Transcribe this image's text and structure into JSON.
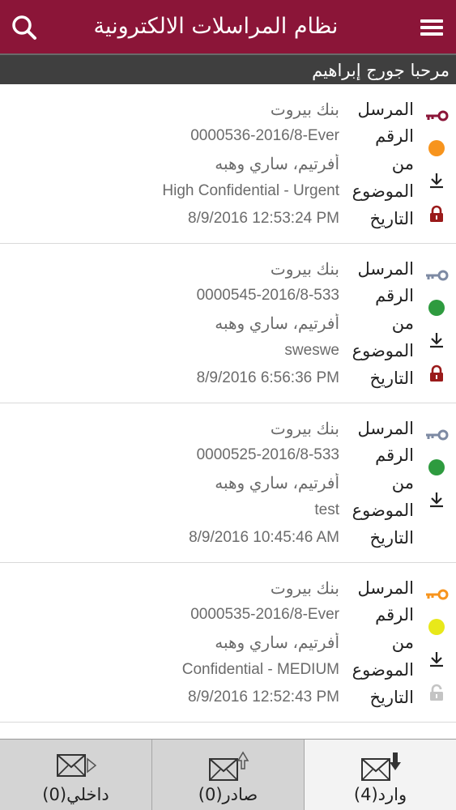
{
  "header": {
    "title": "نظام المراسلات الالكترونية",
    "search_icon": "search-icon",
    "menu_icon": "hamburger-menu-icon"
  },
  "welcome": "مرحبا جورج إبراهيم",
  "colors": {
    "header_bg": "#8b1538",
    "welcome_bg": "#3f3f3f",
    "orange": "#f7941d",
    "green": "#2e9b3f",
    "yellow": "#e8e81a",
    "lock_red": "#9a1a1a"
  },
  "labels": {
    "sender": "المرسل",
    "number": "الرقم",
    "from": "من",
    "subject": "الموضوع",
    "date": "التاريخ"
  },
  "messages": [
    {
      "sender": "بنك بيروت",
      "number": "0000536-2016/8-Ever",
      "from": "أفرتيم، ساري وهبه",
      "subject": "High Confidential - Urgent",
      "date": "8/9/2016 12:53:24 PM",
      "key_color": "#8b1538",
      "priority_color": "#f7941d",
      "lock": "locked-red"
    },
    {
      "sender": "بنك بيروت",
      "number": "0000545-2016/8-533",
      "from": "أفرتيم، ساري وهبه",
      "subject": "sweswe",
      "date": "8/9/2016 6:56:36 PM",
      "key_color": "#7d8aa3",
      "priority_color": "#2e9b3f",
      "lock": "locked-red"
    },
    {
      "sender": "بنك بيروت",
      "number": "0000525-2016/8-533",
      "from": "أفرتيم، ساري وهبه",
      "subject": "test",
      "date": "8/9/2016 10:45:46 AM",
      "key_color": "#7d8aa3",
      "priority_color": "#2e9b3f",
      "lock": "none"
    },
    {
      "sender": "بنك بيروت",
      "number": "0000535-2016/8-Ever",
      "from": "أفرتيم، ساري وهبه",
      "subject": "Confidential - MEDIUM",
      "date": "8/9/2016 12:52:43 PM",
      "key_color": "#f7941d",
      "priority_color": "#e8e81a",
      "lock": "unlocked-gray"
    }
  ],
  "tabs": [
    {
      "label": "داخلي(0)",
      "icon": "internal-mail-icon"
    },
    {
      "label": "صادر(0)",
      "icon": "outgoing-mail-icon"
    },
    {
      "label": "وارد(4)",
      "icon": "incoming-mail-icon",
      "active": true
    }
  ]
}
